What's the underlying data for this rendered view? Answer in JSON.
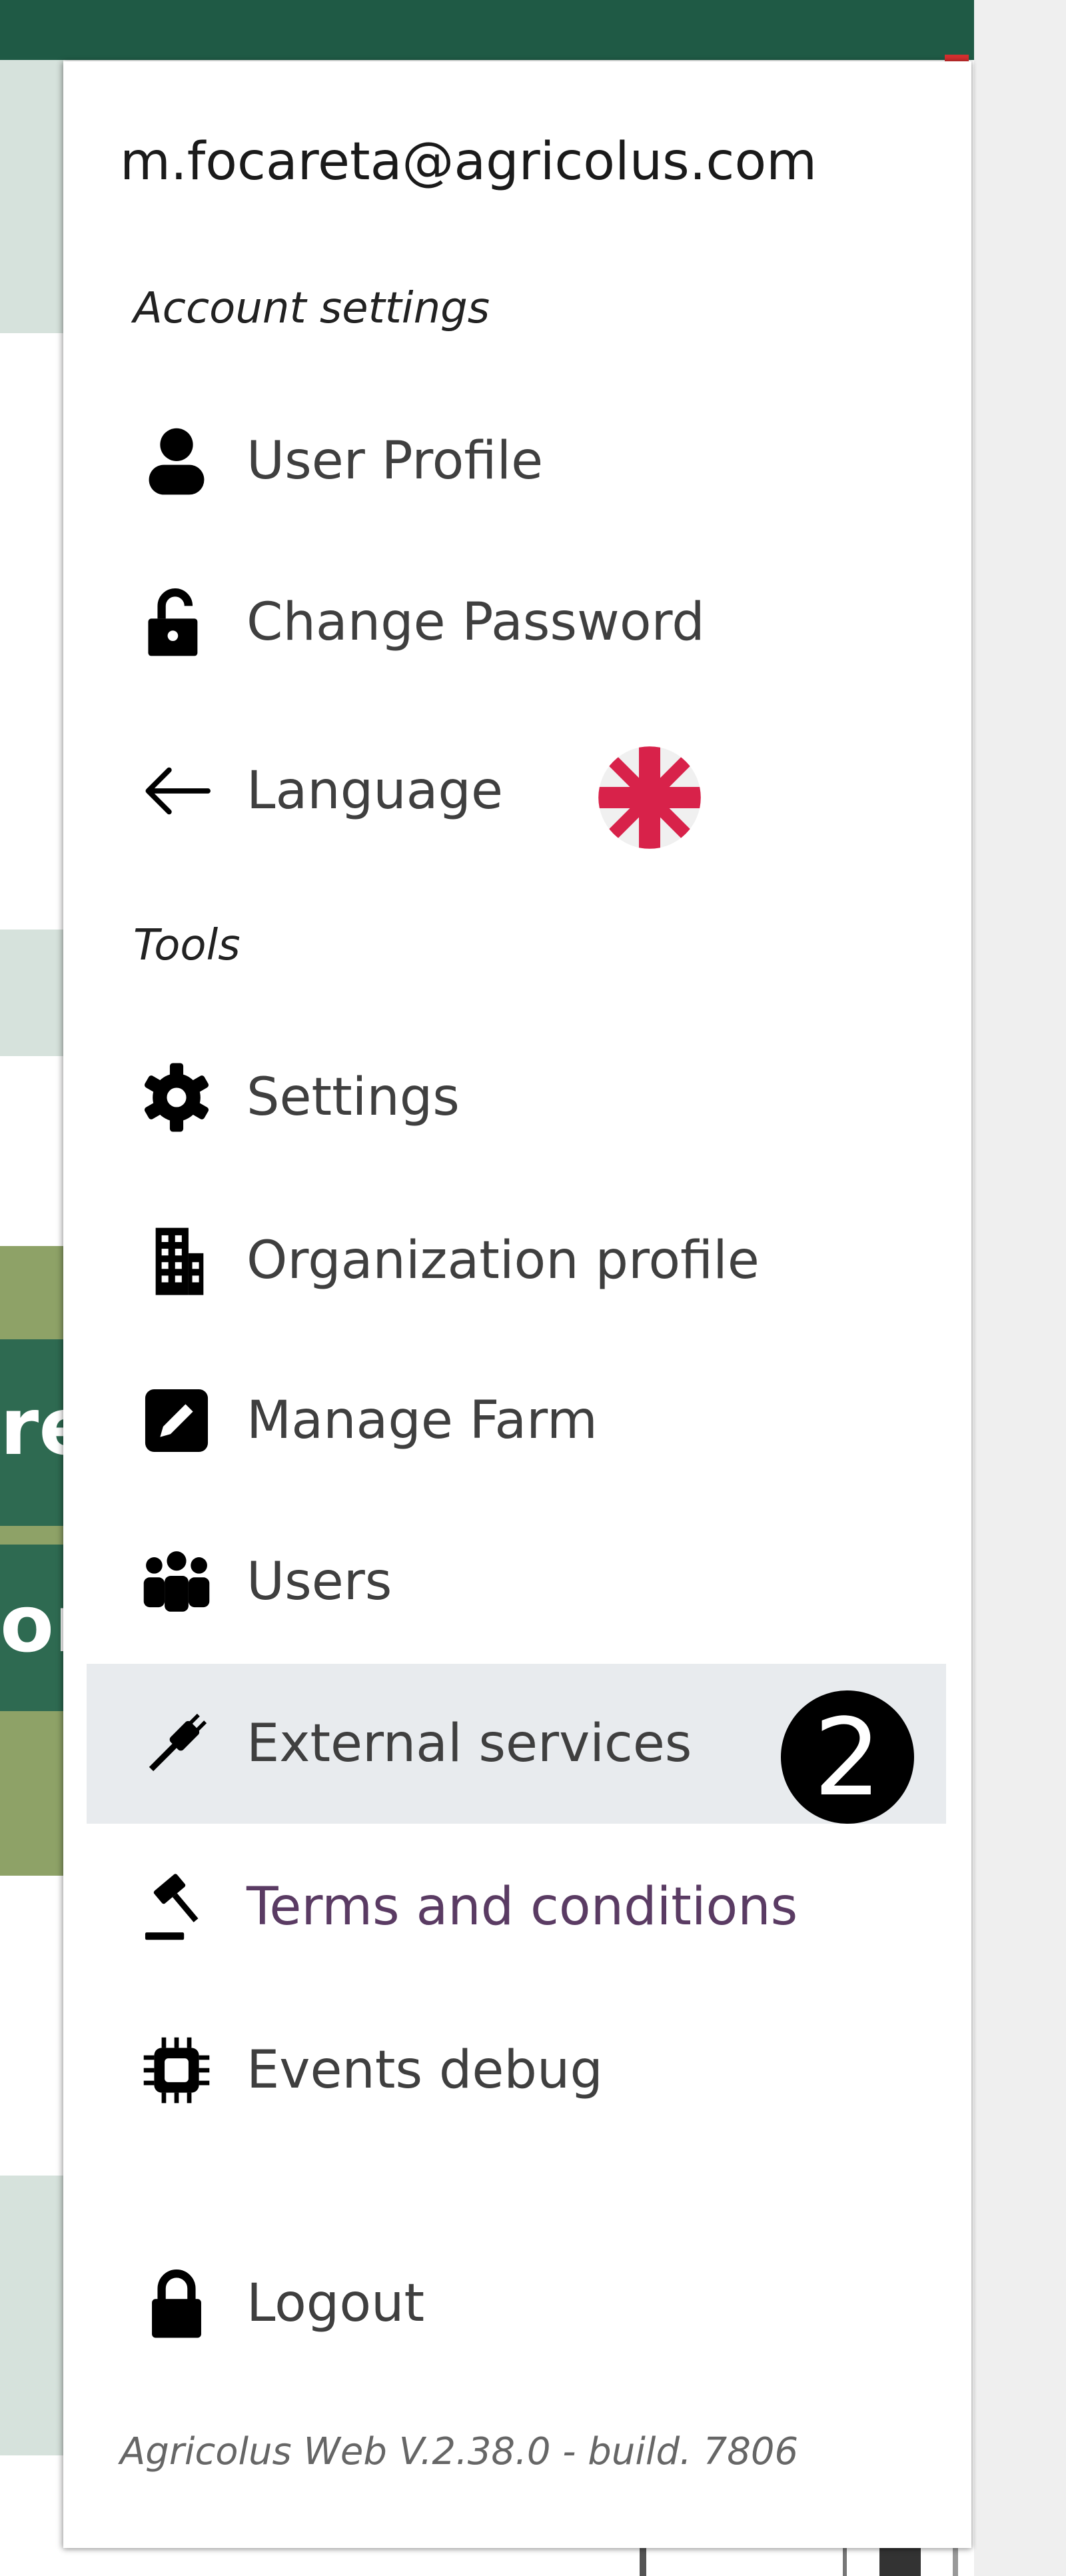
{
  "account": {
    "email": "m.focareta@agricolus.com"
  },
  "sections": {
    "account_settings": "Account settings",
    "tools": "Tools"
  },
  "menu": {
    "user_profile": "User Profile",
    "change_password": "Change Password",
    "language": "Language",
    "settings": "Settings",
    "organization_profile": "Organization profile",
    "manage_farm": "Manage Farm",
    "users": "Users",
    "external_services": "External services",
    "terms": "Terms and conditions",
    "events_debug": "Events debug",
    "logout": "Logout"
  },
  "language_flag": "uk-flag-icon",
  "callout_badge": "2",
  "version": "Agricolus Web V.2.38.0 - build. 7806",
  "background_fragments": [
    "re",
    "or"
  ],
  "colors": {
    "header": "#1f5a45",
    "highlight_bg": "#e8ebee",
    "terms_text": "#5a3b63"
  }
}
